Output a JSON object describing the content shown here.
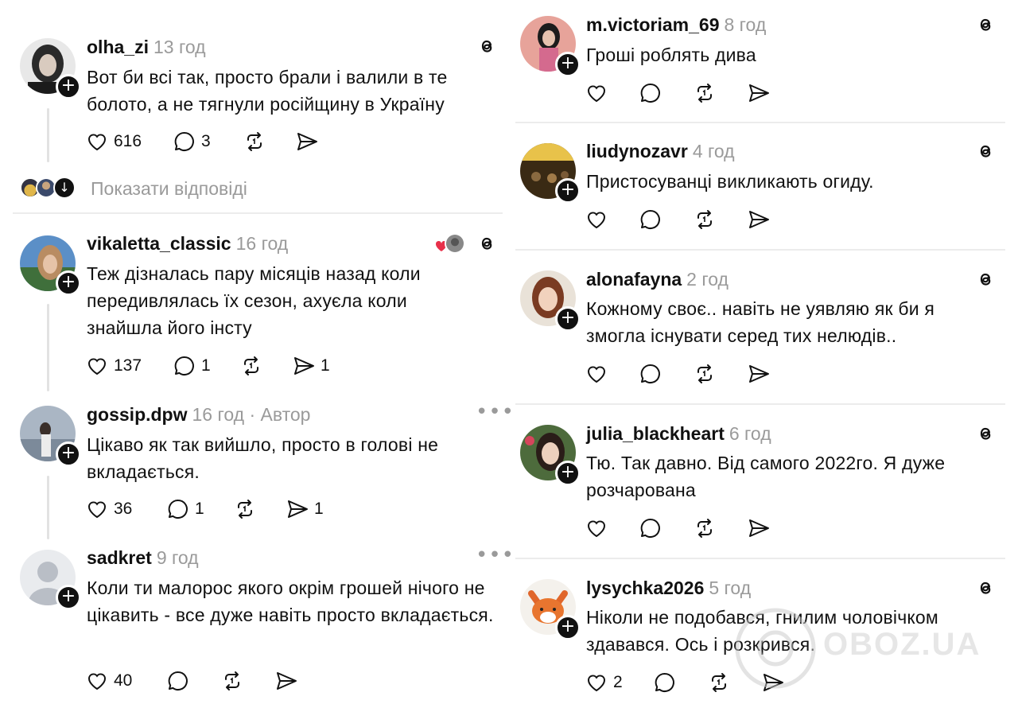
{
  "left_posts": [
    {
      "username": "olha_zi",
      "time": "13 год",
      "text": "Вот би всі так, просто брали і валили в те болото, а не тягнули російщину в Україну",
      "likes": "616",
      "replies": "3",
      "shares": ""
    },
    {
      "username": "vikaletta_classic",
      "time": "16 год",
      "text": "Теж дізналась пару місяців назад коли передивлялась їх сезон, ахуєла коли знайшла його інсту",
      "likes": "137",
      "replies": "1",
      "shares": "1"
    },
    {
      "username": "gossip.dpw",
      "time": "16 год",
      "author": "· Автор",
      "text": "Цікаво як так вийшло, просто в голові не вкладається.",
      "likes": "36",
      "replies": "1",
      "shares": "1"
    },
    {
      "username": "sadkret",
      "time": "9 год",
      "text": "Коли ти малорос якого окрім грошей нічого не цікавить - все дуже навіть просто вкладається.",
      "likes": "40",
      "replies": "",
      "shares": ""
    }
  ],
  "show_replies": "Показати відповіді",
  "right_posts": [
    {
      "username": "m.victoriam_69",
      "time": "8 год",
      "text": "Гроші роблять дива",
      "likes": ""
    },
    {
      "username": "liudynozavr",
      "time": "4 год",
      "text": "Пристосуванці викликають огиду.",
      "likes": ""
    },
    {
      "username": "alonafayna",
      "time": "2 год",
      "text": "Кожному своє.. навіть не уявляю як би я змогла існувати серед тих нелюдів..",
      "likes": ""
    },
    {
      "username": "julia_blackheart",
      "time": "6 год",
      "text": "Тю. Так давно. Від самого 2022го. Я дуже розчарована",
      "likes": ""
    },
    {
      "username": "lysychka2026",
      "time": "5 год",
      "text": "Ніколи не подобався, гнилим чоловічком здавався. Ось і розкрився.",
      "likes": "2"
    }
  ],
  "watermark": "OBOZ.UA",
  "icons": [
    "heart-icon",
    "comment-icon",
    "repost-icon",
    "share-icon",
    "threads-icon",
    "plus-icon",
    "more-icon"
  ]
}
